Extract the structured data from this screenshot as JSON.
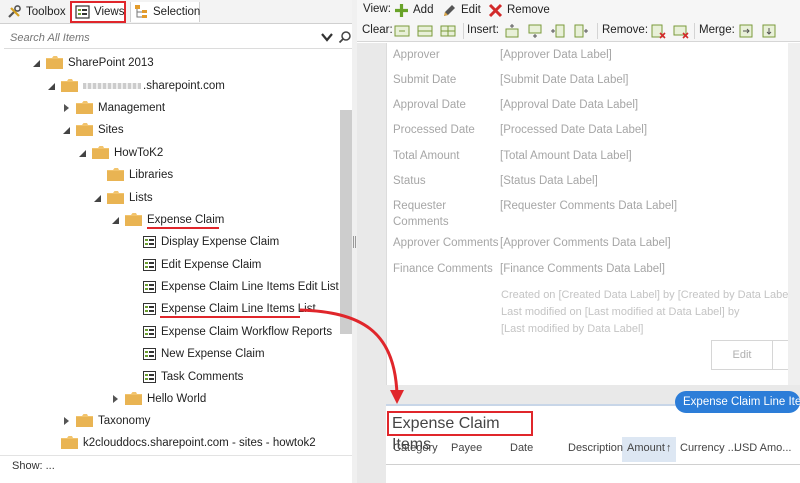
{
  "tabs": {
    "toolbox": "Toolbox",
    "views": "Views",
    "selection": "Selection"
  },
  "search": {
    "placeholder": "Search All Items"
  },
  "tree": [
    {
      "label": "SharePoint 2013",
      "type": "folder",
      "expanded": true
    },
    {
      "label": ".sharepoint.com",
      "type": "folder",
      "expanded": true
    },
    {
      "label": "Management",
      "type": "folder",
      "expanded": false
    },
    {
      "label": "Sites",
      "type": "folder",
      "expanded": true
    },
    {
      "label": "HowToK2",
      "type": "folder",
      "expanded": true
    },
    {
      "label": "Libraries",
      "type": "folder"
    },
    {
      "label": "Lists",
      "type": "folder",
      "expanded": true
    },
    {
      "label": "Expense Claim",
      "type": "folder",
      "expanded": true
    },
    {
      "label": "Display Expense Claim",
      "type": "view"
    },
    {
      "label": "Edit Expense Claim",
      "type": "view"
    },
    {
      "label": "Expense Claim Line Items Edit List",
      "type": "view"
    },
    {
      "label": "Expense Claim Line Items List",
      "type": "view"
    },
    {
      "label": "Expense Claim Workflow Reports",
      "type": "view"
    },
    {
      "label": "New Expense Claim",
      "type": "view"
    },
    {
      "label": "Task Comments",
      "type": "view"
    },
    {
      "label": "Hello World",
      "type": "folder",
      "expanded": false
    },
    {
      "label": "Taxonomy",
      "type": "folder",
      "expanded": false
    },
    {
      "label": "k2clouddocs.sharepoint.com - sites - howtok2",
      "type": "folder"
    }
  ],
  "show_label": "Show: ...",
  "toolbar": {
    "view_label": "View:",
    "add": "Add",
    "edit": "Edit",
    "remove": "Remove",
    "clear_label": "Clear:",
    "insert_label": "Insert:",
    "remove_label": "Remove:",
    "merge_label": "Merge:"
  },
  "form": {
    "rows": [
      {
        "label": "Approver",
        "value": "[Approver Data Label]"
      },
      {
        "label": "Submit Date",
        "value": "[Submit Date Data Label]"
      },
      {
        "label": "Approval Date",
        "value": "[Approval Date Data Label]"
      },
      {
        "label": "Processed Date",
        "value": "[Processed Date Data Label]"
      },
      {
        "label": "Total Amount",
        "value": "[Total Amount Data Label]"
      },
      {
        "label": "Status",
        "value": "[Status Data Label]"
      },
      {
        "label": "Requester",
        "label2": "Comments",
        "value": "[Requester Comments Data Label]"
      },
      {
        "label": "Approver Comments",
        "value": "[Approver Comments Data Label]"
      },
      {
        "label": "Finance Comments",
        "value": "[Finance Comments Data Label]"
      }
    ],
    "footer": [
      "Created on [Created Data Label] by [Created by Data Label]",
      "Last modified on [Last modified at Data Label] by",
      "[Last modified by Data Label]"
    ],
    "edit_button": "Edit"
  },
  "items": {
    "title": "Expense Claim Items",
    "pill": "Expense Claim Line Items",
    "columns": [
      "Category",
      "Payee",
      "Date",
      "Description",
      "Amount",
      "Currency ...",
      "USD Amo..."
    ],
    "sort_indicator": "↑"
  },
  "colors": {
    "annotation": "#e0262b",
    "pill": "#2c7dd8",
    "folder": "#f2c46d",
    "add_icon": "#69a329",
    "remove_icon": "#d22a2a"
  }
}
